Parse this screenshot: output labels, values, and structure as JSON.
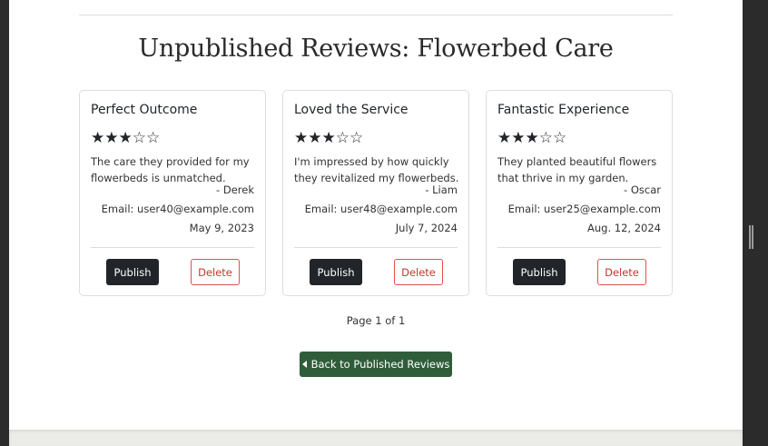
{
  "page": {
    "title": "Unpublished Reviews: Flowerbed Care",
    "pagination": "Page 1 of 1",
    "back_button": "Back to Published Reviews"
  },
  "reviews": [
    {
      "title": "Perfect Outcome",
      "rating": 3,
      "stars": "★★★☆☆",
      "text": "The care they provided for my flowerbeds is unmatched.",
      "author": "- Derek",
      "email": "Email: user40@example.com",
      "date": "May 9, 2023",
      "publish_label": "Publish",
      "delete_label": "Delete"
    },
    {
      "title": "Loved the Service",
      "rating": 3,
      "stars": "★★★☆☆",
      "text": "I'm impressed by how quickly they revitalized my flowerbeds.",
      "author": "- Liam",
      "email": "Email: user48@example.com",
      "date": "July 7, 2024",
      "publish_label": "Publish",
      "delete_label": "Delete"
    },
    {
      "title": "Fantastic Experience",
      "rating": 3,
      "stars": "★★★☆☆",
      "text": "They planted beautiful flowers that thrive in my garden.",
      "author": "- Oscar",
      "email": "Email: user25@example.com",
      "date": "Aug. 12, 2024",
      "publish_label": "Publish",
      "delete_label": "Delete"
    }
  ],
  "colors": {
    "publish_bg": "#212529",
    "delete_border": "#d9534f",
    "back_bg": "#2f5d3a"
  },
  "icons": {
    "back": "caret-left-icon"
  }
}
